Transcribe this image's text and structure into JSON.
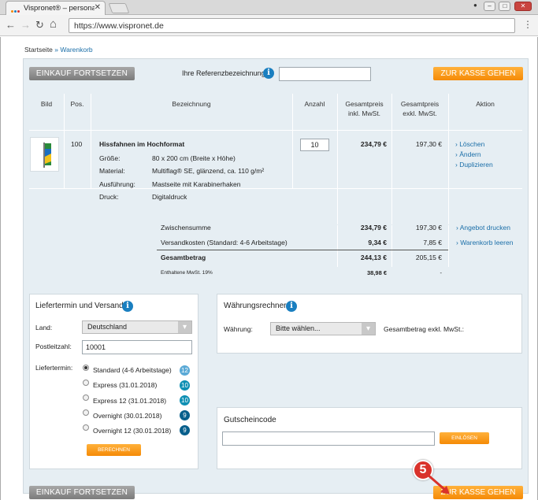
{
  "browser": {
    "tab_title": "Vispronet® – personalisi",
    "tab_close": "✕",
    "url": "https://www.vispronet.de"
  },
  "breadcrumb": {
    "home": "Startseite",
    "sep": "»",
    "current": "Warenkorb"
  },
  "top_bar": {
    "continue_label": "EINKAUF FORTSETZEN",
    "reference_label": "Ihre Referenzbezeichnung",
    "reference_value": "",
    "checkout_label": "ZUR KASSE GEHEN"
  },
  "table": {
    "headers": {
      "bild": "Bild",
      "pos": "Pos.",
      "bezeichnung": "Bezeichnung",
      "anzahl": "Anzahl",
      "gesamt_inkl_1": "Gesamtpreis",
      "gesamt_inkl_2": "inkl. MwSt.",
      "gesamt_exkl_1": "Gesamtpreis",
      "gesamt_exkl_2": "exkl. MwSt.",
      "aktion": "Aktion"
    },
    "row": {
      "pos": "100",
      "product_name": "Hissfahnen im Hochformat",
      "details": [
        {
          "label": "Größe:",
          "value": "80 x 200 cm (Breite x Höhe)"
        },
        {
          "label": "Material:",
          "value": "Multiflag® SE, glänzend, ca. 110 g/m²"
        },
        {
          "label": "Ausführung:",
          "value": "Mastseite mit Karabinerhaken"
        },
        {
          "label": "Druck:",
          "value": "Digitaldruck"
        }
      ],
      "quantity": "10",
      "price_inkl": "234,79 €",
      "price_exkl": "197,30 €",
      "actions": [
        "› Löschen",
        "› Ändern",
        "› Duplizieren"
      ]
    }
  },
  "summary": {
    "subtotal_label": "Zwischensumme",
    "subtotal_inkl": "234,79 €",
    "subtotal_exkl": "197,30 €",
    "shipping_label": "Versandkosten (Standard: 4-6 Arbeitstage)",
    "shipping_inkl": "9,34 €",
    "shipping_exkl": "7,85 €",
    "total_label": "Gesamtbetrag",
    "total_inkl": "244,13 €",
    "total_exkl": "205,15 €",
    "vat_label": "Enthaltene MwSt. 19%",
    "vat_inkl": "38,98 €",
    "vat_exkl": "-",
    "links": [
      "› Angebot drucken",
      "› Warenkorb leeren"
    ]
  },
  "delivery": {
    "title": "Liefertermin und Versand",
    "country_label": "Land:",
    "country_value": "Deutschland",
    "zip_label": "Postleitzahl:",
    "zip_value": "10001",
    "date_label": "Liefertermin:",
    "options": [
      {
        "label": "Standard (4-6 Arbeitstage)",
        "days": "12",
        "checked": true
      },
      {
        "label": "Express (31.01.2018)",
        "days": "10",
        "checked": false
      },
      {
        "label": "Express 12 (31.01.2018)",
        "days": "10",
        "checked": false
      },
      {
        "label": "Overnight (30.01.2018)",
        "days": "9",
        "checked": false
      },
      {
        "label": "Overnight 12 (30.01.2018)",
        "days": "9",
        "checked": false
      }
    ],
    "calc_label": "BERECHNEN"
  },
  "currency": {
    "title": "Währungsrechner",
    "currency_label": "Währung:",
    "currency_value": "Bitte wählen...",
    "total_label": "Gesamtbetrag exkl. MwSt.:"
  },
  "voucher": {
    "title": "Gutscheincode",
    "code_value": "",
    "redeem_label": "EINLÖSEN"
  },
  "bottom_bar": {
    "continue_label": "EINKAUF FORTSETZEN",
    "checkout_label": "ZUR KASSE GEHEN"
  },
  "annotation": {
    "step": "5"
  },
  "colors": {
    "accent_orange": "#f58a06",
    "link_blue": "#1a6ea8",
    "info_blue": "#1a7fc0",
    "badge_light": "#5aa9d6",
    "badge_teal": "#0e8fb3",
    "badge_dark": "#075f8c",
    "step_red": "#d9322b"
  },
  "icons": {
    "info": "i",
    "back": "←",
    "forward": "→",
    "reload": "↻",
    "home": "⌂",
    "menu": "⋮",
    "select_arrow": "▾"
  }
}
